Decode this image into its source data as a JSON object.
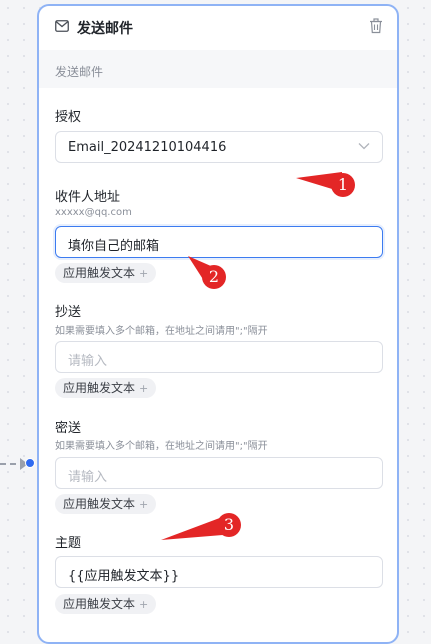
{
  "node": {
    "title": "发送邮件",
    "description": "发送邮件"
  },
  "auth": {
    "label": "授权",
    "value": "Email_20241210104416"
  },
  "recipient": {
    "label": "收件人地址",
    "hint": "xxxxx@qq.com",
    "value": "填你自己的邮箱",
    "chip": "应用触发文本"
  },
  "cc": {
    "label": "抄送",
    "hint": "如果需要填入多个邮箱，在地址之间请用\";\"隔开",
    "placeholder": "请输入",
    "chip": "应用触发文本"
  },
  "bcc": {
    "label": "密送",
    "hint": "如果需要填入多个邮箱，在地址之间请用\";\"隔开",
    "placeholder": "请输入",
    "chip": "应用触发文本"
  },
  "subject": {
    "label": "主题",
    "value": "{{应用触发文本}}",
    "chip": "应用触发文本"
  },
  "chip_plus": "+",
  "annotations": [
    "1",
    "2",
    "3"
  ],
  "colors": {
    "accent": "#3c7bf0",
    "card_border": "#8fb3f5",
    "annotation": "#e32626"
  }
}
